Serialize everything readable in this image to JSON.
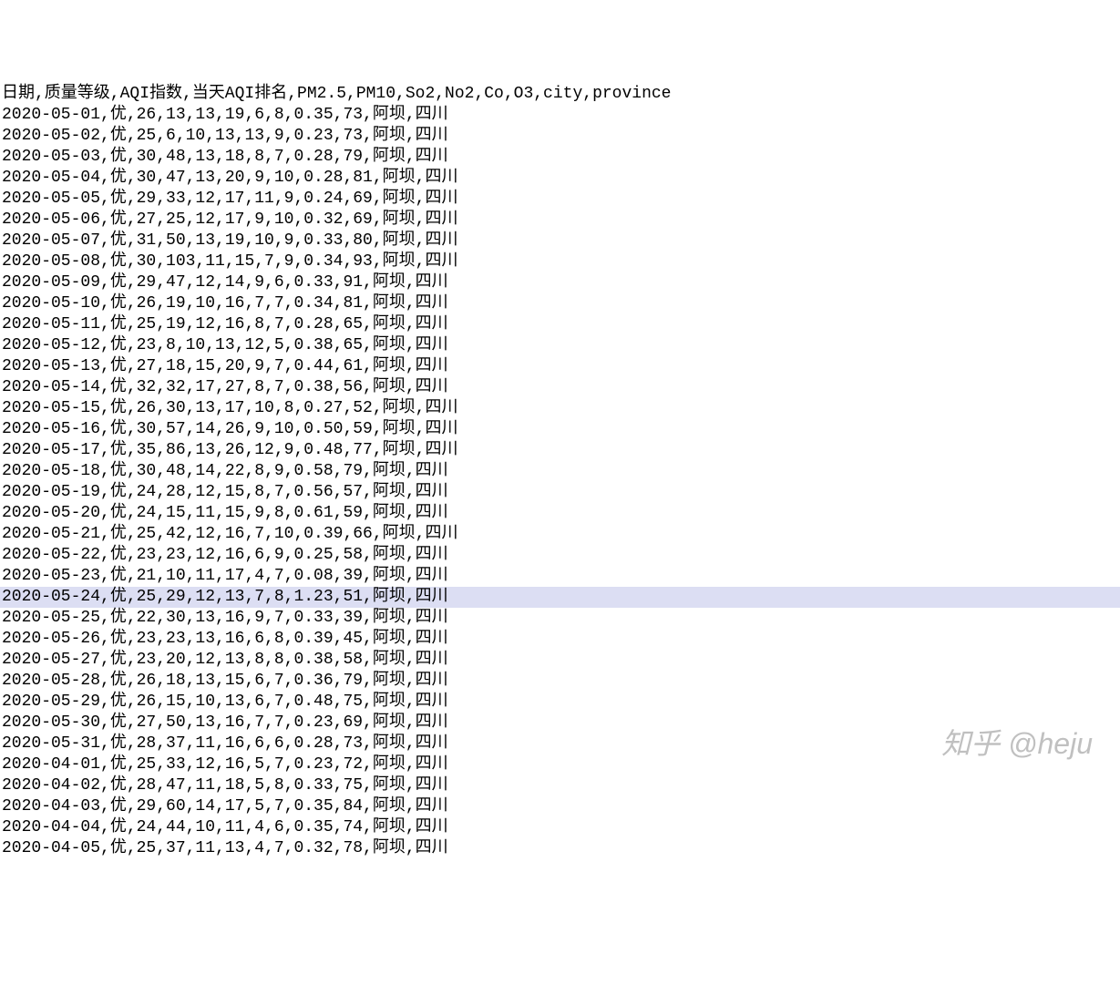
{
  "header": "日期,质量等级,AQI指数,当天AQI排名,PM2.5,PM10,So2,No2,Co,O3,city,province",
  "highlighted_index": 24,
  "rows": [
    {
      "日期": "2020-05-01",
      "质量等级": "优",
      "AQI指数": "26",
      "当天AQI排名": "13",
      "PM2.5": "13",
      "PM10": "19",
      "So2": "6",
      "No2": "8",
      "Co": "0.35",
      "O3": "73",
      "city": "阿坝",
      "province": "四川"
    },
    {
      "日期": "2020-05-02",
      "质量等级": "优",
      "AQI指数": "25",
      "当天AQI排名": "6",
      "PM2.5": "10",
      "PM10": "13",
      "So2": "13",
      "No2": "9",
      "Co": "0.23",
      "O3": "73",
      "city": "阿坝",
      "province": "四川"
    },
    {
      "日期": "2020-05-03",
      "质量等级": "优",
      "AQI指数": "30",
      "当天AQI排名": "48",
      "PM2.5": "13",
      "PM10": "18",
      "So2": "8",
      "No2": "7",
      "Co": "0.28",
      "O3": "79",
      "city": "阿坝",
      "province": "四川"
    },
    {
      "日期": "2020-05-04",
      "质量等级": "优",
      "AQI指数": "30",
      "当天AQI排名": "47",
      "PM2.5": "13",
      "PM10": "20",
      "So2": "9",
      "No2": "10",
      "Co": "0.28",
      "O3": "81",
      "city": "阿坝",
      "province": "四川"
    },
    {
      "日期": "2020-05-05",
      "质量等级": "优",
      "AQI指数": "29",
      "当天AQI排名": "33",
      "PM2.5": "12",
      "PM10": "17",
      "So2": "11",
      "No2": "9",
      "Co": "0.24",
      "O3": "69",
      "city": "阿坝",
      "province": "四川"
    },
    {
      "日期": "2020-05-06",
      "质量等级": "优",
      "AQI指数": "27",
      "当天AQI排名": "25",
      "PM2.5": "12",
      "PM10": "17",
      "So2": "9",
      "No2": "10",
      "Co": "0.32",
      "O3": "69",
      "city": "阿坝",
      "province": "四川"
    },
    {
      "日期": "2020-05-07",
      "质量等级": "优",
      "AQI指数": "31",
      "当天AQI排名": "50",
      "PM2.5": "13",
      "PM10": "19",
      "So2": "10",
      "No2": "9",
      "Co": "0.33",
      "O3": "80",
      "city": "阿坝",
      "province": "四川"
    },
    {
      "日期": "2020-05-08",
      "质量等级": "优",
      "AQI指数": "30",
      "当天AQI排名": "103",
      "PM2.5": "11",
      "PM10": "15",
      "So2": "7",
      "No2": "9",
      "Co": "0.34",
      "O3": "93",
      "city": "阿坝",
      "province": "四川"
    },
    {
      "日期": "2020-05-09",
      "质量等级": "优",
      "AQI指数": "29",
      "当天AQI排名": "47",
      "PM2.5": "12",
      "PM10": "14",
      "So2": "9",
      "No2": "6",
      "Co": "0.33",
      "O3": "91",
      "city": "阿坝",
      "province": "四川"
    },
    {
      "日期": "2020-05-10",
      "质量等级": "优",
      "AQI指数": "26",
      "当天AQI排名": "19",
      "PM2.5": "10",
      "PM10": "16",
      "So2": "7",
      "No2": "7",
      "Co": "0.34",
      "O3": "81",
      "city": "阿坝",
      "province": "四川"
    },
    {
      "日期": "2020-05-11",
      "质量等级": "优",
      "AQI指数": "25",
      "当天AQI排名": "19",
      "PM2.5": "12",
      "PM10": "16",
      "So2": "8",
      "No2": "7",
      "Co": "0.28",
      "O3": "65",
      "city": "阿坝",
      "province": "四川"
    },
    {
      "日期": "2020-05-12",
      "质量等级": "优",
      "AQI指数": "23",
      "当天AQI排名": "8",
      "PM2.5": "10",
      "PM10": "13",
      "So2": "12",
      "No2": "5",
      "Co": "0.38",
      "O3": "65",
      "city": "阿坝",
      "province": "四川"
    },
    {
      "日期": "2020-05-13",
      "质量等级": "优",
      "AQI指数": "27",
      "当天AQI排名": "18",
      "PM2.5": "15",
      "PM10": "20",
      "So2": "9",
      "No2": "7",
      "Co": "0.44",
      "O3": "61",
      "city": "阿坝",
      "province": "四川"
    },
    {
      "日期": "2020-05-14",
      "质量等级": "优",
      "AQI指数": "32",
      "当天AQI排名": "32",
      "PM2.5": "17",
      "PM10": "27",
      "So2": "8",
      "No2": "7",
      "Co": "0.38",
      "O3": "56",
      "city": "阿坝",
      "province": "四川"
    },
    {
      "日期": "2020-05-15",
      "质量等级": "优",
      "AQI指数": "26",
      "当天AQI排名": "30",
      "PM2.5": "13",
      "PM10": "17",
      "So2": "10",
      "No2": "8",
      "Co": "0.27",
      "O3": "52",
      "city": "阿坝",
      "province": "四川"
    },
    {
      "日期": "2020-05-16",
      "质量等级": "优",
      "AQI指数": "30",
      "当天AQI排名": "57",
      "PM2.5": "14",
      "PM10": "26",
      "So2": "9",
      "No2": "10",
      "Co": "0.50",
      "O3": "59",
      "city": "阿坝",
      "province": "四川"
    },
    {
      "日期": "2020-05-17",
      "质量等级": "优",
      "AQI指数": "35",
      "当天AQI排名": "86",
      "PM2.5": "13",
      "PM10": "26",
      "So2": "12",
      "No2": "9",
      "Co": "0.48",
      "O3": "77",
      "city": "阿坝",
      "province": "四川"
    },
    {
      "日期": "2020-05-18",
      "质量等级": "优",
      "AQI指数": "30",
      "当天AQI排名": "48",
      "PM2.5": "14",
      "PM10": "22",
      "So2": "8",
      "No2": "9",
      "Co": "0.58",
      "O3": "79",
      "city": "阿坝",
      "province": "四川"
    },
    {
      "日期": "2020-05-19",
      "质量等级": "优",
      "AQI指数": "24",
      "当天AQI排名": "28",
      "PM2.5": "12",
      "PM10": "15",
      "So2": "8",
      "No2": "7",
      "Co": "0.56",
      "O3": "57",
      "city": "阿坝",
      "province": "四川"
    },
    {
      "日期": "2020-05-20",
      "质量等级": "优",
      "AQI指数": "24",
      "当天AQI排名": "15",
      "PM2.5": "11",
      "PM10": "15",
      "So2": "9",
      "No2": "8",
      "Co": "0.61",
      "O3": "59",
      "city": "阿坝",
      "province": "四川"
    },
    {
      "日期": "2020-05-21",
      "质量等级": "优",
      "AQI指数": "25",
      "当天AQI排名": "42",
      "PM2.5": "12",
      "PM10": "16",
      "So2": "7",
      "No2": "10",
      "Co": "0.39",
      "O3": "66",
      "city": "阿坝",
      "province": "四川"
    },
    {
      "日期": "2020-05-22",
      "质量等级": "优",
      "AQI指数": "23",
      "当天AQI排名": "23",
      "PM2.5": "12",
      "PM10": "16",
      "So2": "6",
      "No2": "9",
      "Co": "0.25",
      "O3": "58",
      "city": "阿坝",
      "province": "四川"
    },
    {
      "日期": "2020-05-23",
      "质量等级": "优",
      "AQI指数": "21",
      "当天AQI排名": "10",
      "PM2.5": "11",
      "PM10": "17",
      "So2": "4",
      "No2": "7",
      "Co": "0.08",
      "O3": "39",
      "city": "阿坝",
      "province": "四川"
    },
    {
      "日期": "2020-05-24",
      "质量等级": "优",
      "AQI指数": "25",
      "当天AQI排名": "29",
      "PM2.5": "12",
      "PM10": "13",
      "So2": "7",
      "No2": "8",
      "Co": "1.23",
      "O3": "51",
      "city": "阿坝",
      "province": "四川"
    },
    {
      "日期": "2020-05-25",
      "质量等级": "优",
      "AQI指数": "22",
      "当天AQI排名": "30",
      "PM2.5": "13",
      "PM10": "16",
      "So2": "9",
      "No2": "7",
      "Co": "0.33",
      "O3": "39",
      "city": "阿坝",
      "province": "四川"
    },
    {
      "日期": "2020-05-26",
      "质量等级": "优",
      "AQI指数": "23",
      "当天AQI排名": "23",
      "PM2.5": "13",
      "PM10": "16",
      "So2": "6",
      "No2": "8",
      "Co": "0.39",
      "O3": "45",
      "city": "阿坝",
      "province": "四川"
    },
    {
      "日期": "2020-05-27",
      "质量等级": "优",
      "AQI指数": "23",
      "当天AQI排名": "20",
      "PM2.5": "12",
      "PM10": "13",
      "So2": "8",
      "No2": "8",
      "Co": "0.38",
      "O3": "58",
      "city": "阿坝",
      "province": "四川"
    },
    {
      "日期": "2020-05-28",
      "质量等级": "优",
      "AQI指数": "26",
      "当天AQI排名": "18",
      "PM2.5": "13",
      "PM10": "15",
      "So2": "6",
      "No2": "7",
      "Co": "0.36",
      "O3": "79",
      "city": "阿坝",
      "province": "四川"
    },
    {
      "日期": "2020-05-29",
      "质量等级": "优",
      "AQI指数": "26",
      "当天AQI排名": "15",
      "PM2.5": "10",
      "PM10": "13",
      "So2": "6",
      "No2": "7",
      "Co": "0.48",
      "O3": "75",
      "city": "阿坝",
      "province": "四川"
    },
    {
      "日期": "2020-05-30",
      "质量等级": "优",
      "AQI指数": "27",
      "当天AQI排名": "50",
      "PM2.5": "13",
      "PM10": "16",
      "So2": "7",
      "No2": "7",
      "Co": "0.23",
      "O3": "69",
      "city": "阿坝",
      "province": "四川"
    },
    {
      "日期": "2020-05-31",
      "质量等级": "优",
      "AQI指数": "28",
      "当天AQI排名": "37",
      "PM2.5": "11",
      "PM10": "16",
      "So2": "6",
      "No2": "6",
      "Co": "0.28",
      "O3": "73",
      "city": "阿坝",
      "province": "四川"
    },
    {
      "日期": "2020-04-01",
      "质量等级": "优",
      "AQI指数": "25",
      "当天AQI排名": "33",
      "PM2.5": "12",
      "PM10": "16",
      "So2": "5",
      "No2": "7",
      "Co": "0.23",
      "O3": "72",
      "city": "阿坝",
      "province": "四川"
    },
    {
      "日期": "2020-04-02",
      "质量等级": "优",
      "AQI指数": "28",
      "当天AQI排名": "47",
      "PM2.5": "11",
      "PM10": "18",
      "So2": "5",
      "No2": "8",
      "Co": "0.33",
      "O3": "75",
      "city": "阿坝",
      "province": "四川"
    },
    {
      "日期": "2020-04-03",
      "质量等级": "优",
      "AQI指数": "29",
      "当天AQI排名": "60",
      "PM2.5": "14",
      "PM10": "17",
      "So2": "5",
      "No2": "7",
      "Co": "0.35",
      "O3": "84",
      "city": "阿坝",
      "province": "四川"
    },
    {
      "日期": "2020-04-04",
      "质量等级": "优",
      "AQI指数": "24",
      "当天AQI排名": "44",
      "PM2.5": "10",
      "PM10": "11",
      "So2": "4",
      "No2": "6",
      "Co": "0.35",
      "O3": "74",
      "city": "阿坝",
      "province": "四川"
    },
    {
      "日期": "2020-04-05",
      "质量等级": "优",
      "AQI指数": "25",
      "当天AQI排名": "37",
      "PM2.5": "11",
      "PM10": "13",
      "So2": "4",
      "No2": "7",
      "Co": "0.32",
      "O3": "78",
      "city": "阿坝",
      "province": "四川"
    }
  ],
  "watermark": "知乎 @heju"
}
